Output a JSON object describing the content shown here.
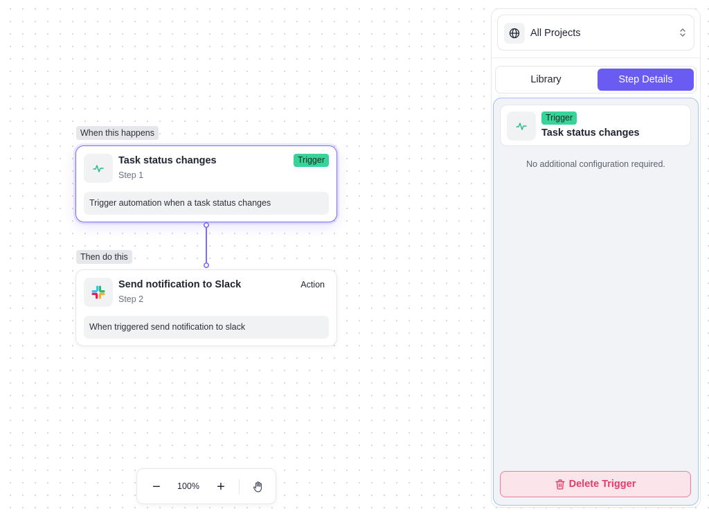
{
  "canvas": {
    "when_label": "When this happens",
    "then_label": "Then do this",
    "trigger_node": {
      "title": "Task status changes",
      "step": "Step 1",
      "badge": "Trigger",
      "description": "Trigger automation when a task status changes",
      "icon": "activity-icon"
    },
    "action_node": {
      "title": "Send notification to Slack",
      "step": "Step 2",
      "badge": "Action",
      "description": "When triggered send notification to slack",
      "icon": "slack-icon"
    },
    "zoom": {
      "minus": "−",
      "level": "100%",
      "plus": "+",
      "hand_icon": "hand-icon"
    }
  },
  "panel": {
    "project_select": {
      "label": "All Projects",
      "icon": "globe-icon",
      "chevron": "chevron-updown-icon"
    },
    "tabs": [
      {
        "label": "Library",
        "active": false
      },
      {
        "label": "Step Details",
        "active": true
      }
    ],
    "details": {
      "badge": "Trigger",
      "title": "Task status changes",
      "message": "No additional configuration required."
    },
    "delete_button": "Delete Trigger"
  },
  "colors": {
    "accent": "#6a5cf2",
    "trigger_badge": "#37d39a",
    "danger": "#e23d69",
    "selection_border": "#9ec5ef"
  }
}
